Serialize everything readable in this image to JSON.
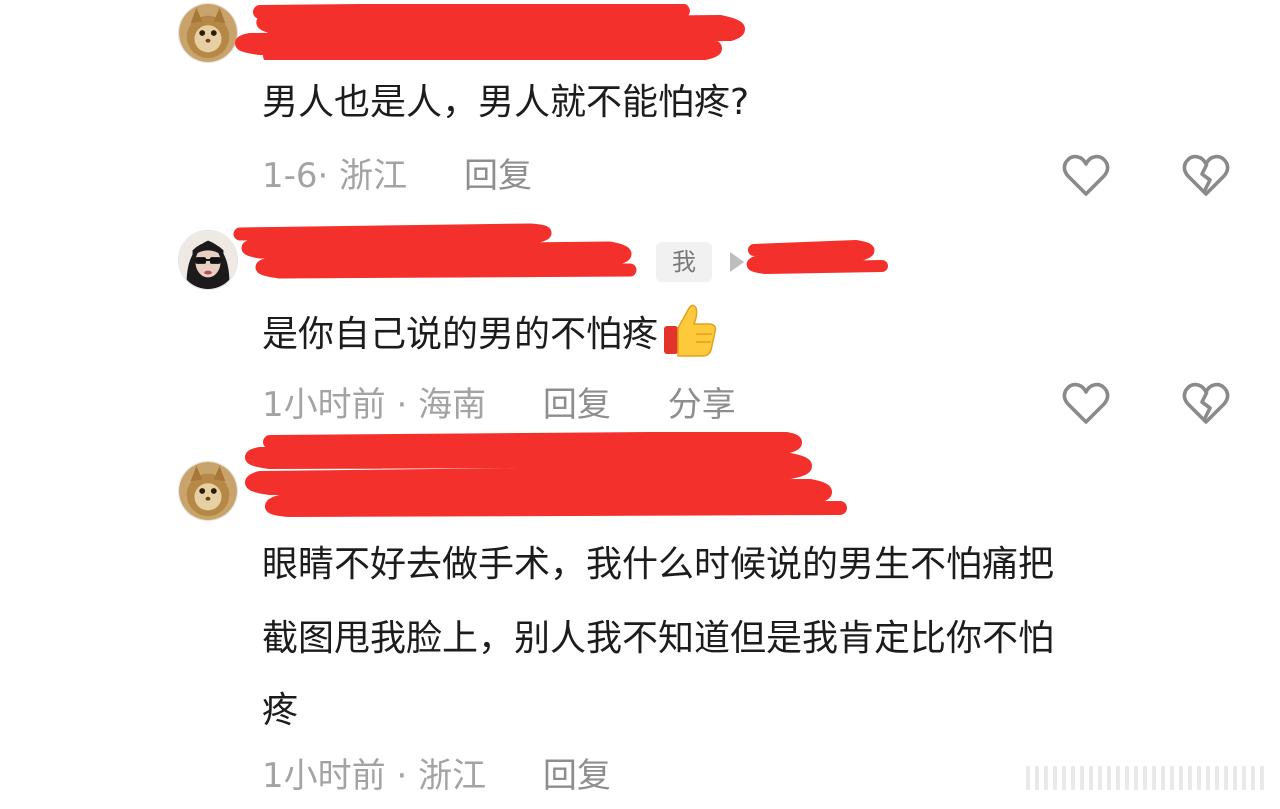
{
  "comments": [
    {
      "username": "",
      "body": "男人也是人，男人就不能怕疼?",
      "date": "1-6",
      "location": "浙江",
      "separator": "· ",
      "reply_label": "回复"
    },
    {
      "username": "",
      "me_badge": "我",
      "reply_to": "",
      "body": "是你自己说的男的不怕疼",
      "date": "1小时前",
      "location": "海南",
      "separator": " · ",
      "reply_label": "回复",
      "share_label": "分享"
    },
    {
      "username": "",
      "body_lines": [
        "眼睛不好去做手术，我什么时候说的男生不怕痛把",
        "截图甩我脸上，别人我不知道但是我肯定比你不怕",
        "疼"
      ],
      "date": "1小时前",
      "location": "浙江",
      "separator": " · ",
      "reply_label": "回复"
    }
  ],
  "icons": {
    "like": "heart-outline-icon",
    "dislike": "broken-heart-icon",
    "thumbs_up": "thumbs-up-emoji"
  },
  "colors": {
    "redaction": "#f4302c",
    "text": "#1c1c1c",
    "meta": "#a3a3a3",
    "icon": "#8a8a8a"
  }
}
